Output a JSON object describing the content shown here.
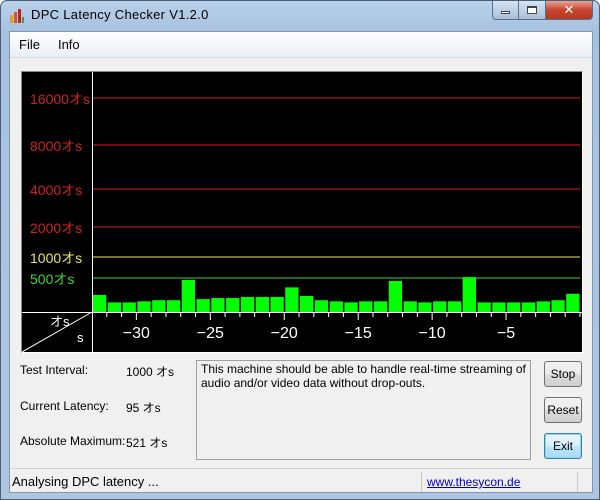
{
  "window": {
    "title": "DPC Latency Checker V1.2.0",
    "minimize": "minimize",
    "maximize": "maximize",
    "close": "close"
  },
  "menu": [
    {
      "label": "File"
    },
    {
      "label": "Info"
    }
  ],
  "chart_data": {
    "type": "bar",
    "title": "",
    "xlabel": "s",
    "ylabel": "µs",
    "axis_corner_labels": {
      "y_unit": "オs",
      "x_unit": "s"
    },
    "x_ticks": [
      -30,
      -25,
      -20,
      -15,
      -10,
      -5
    ],
    "x_tick_labels": [
      "−30",
      "−25",
      "−20",
      "−15",
      "−10",
      "−5"
    ],
    "xlim": [
      -33,
      0
    ],
    "threshold_lines": [
      {
        "value": 16000,
        "label": "16000オs",
        "color": "#d02020"
      },
      {
        "value": 8000,
        "label": "8000オs",
        "color": "#d02020"
      },
      {
        "value": 4000,
        "label": "4000オs",
        "color": "#d02020"
      },
      {
        "value": 2000,
        "label": "2000オs",
        "color": "#d02020"
      },
      {
        "value": 1000,
        "label": "1000オs",
        "color": "#e8e860"
      },
      {
        "value": 500,
        "label": "500オs",
        "color": "#40d040"
      }
    ],
    "bar_color": "#00ff00",
    "values": [
      250,
      141,
      141,
      157,
      173,
      173,
      471,
      189,
      205,
      205,
      221,
      221,
      221,
      362,
      236,
      173,
      157,
      141,
      157,
      157,
      456,
      157,
      141,
      157,
      157,
      521,
      141,
      141,
      141,
      141,
      157,
      173,
      268
    ]
  },
  "stats": {
    "test_interval_label": "Test Interval:",
    "test_interval_value": "1000 オs",
    "current_latency_label": "Current Latency:",
    "current_latency_value": "95 オs",
    "absolute_max_label": "Absolute Maximum:",
    "absolute_max_value": "521 オs"
  },
  "message": "This machine should be able to handle real-time streaming of audio and/or video data without drop-outs.",
  "buttons": {
    "stop": "Stop",
    "reset": "Reset",
    "exit": "Exit"
  },
  "status": {
    "text": "Analysing DPC latency ...",
    "link": "www.thesycon.de"
  }
}
